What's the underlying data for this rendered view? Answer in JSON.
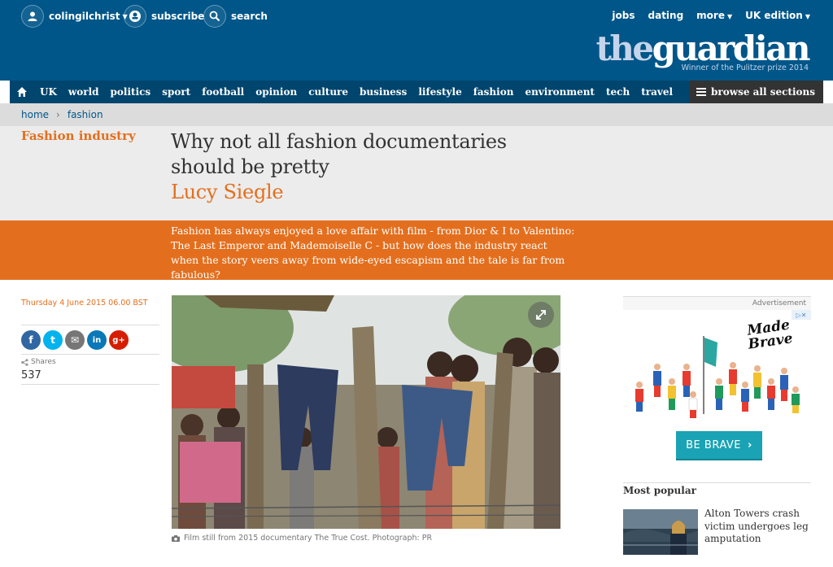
{
  "header": {
    "user_label": "colingilchrist",
    "subscribe_label": "subscribe",
    "search_label": "search",
    "right_links": [
      "jobs",
      "dating",
      "more",
      "UK edition"
    ],
    "logo_the": "the",
    "logo_guardian": "guardian",
    "logo_tagline": "Winner of the Pulitzer prize 2014"
  },
  "nav": {
    "items": [
      "UK",
      "world",
      "politics",
      "sport",
      "football",
      "opinion",
      "culture",
      "business",
      "lifestyle",
      "fashion",
      "environment",
      "tech",
      "travel"
    ],
    "browse_label": "browse all sections"
  },
  "breadcrumb": [
    "home",
    "fashion"
  ],
  "article": {
    "section": "Fashion industry",
    "headline": "Why not all fashion documentaries should be pretty",
    "byline": "Lucy Siegle",
    "standfirst": "Fashion has always enjoyed a love affair with film - from Dior & I to Valentino: The Last Emperor and Mademoiselle C - but how does the industry react when the story veers away from wide-eyed escapism and the tale is far from fabulous?",
    "date": "Thursday 4 June 2015 06.00 BST",
    "shares_label": "Shares",
    "shares_count": "537",
    "caption": "Film still from 2015 documentary The True Cost. Photograph: PR"
  },
  "share_buttons": [
    {
      "name": "facebook",
      "glyph": "f",
      "color": "#3067a3"
    },
    {
      "name": "twitter",
      "glyph": "t",
      "color": "#03b3ee"
    },
    {
      "name": "email",
      "glyph": "✉",
      "color": "#767676"
    },
    {
      "name": "linkedin",
      "glyph": "in",
      "color": "#0b78b7"
    },
    {
      "name": "googleplus",
      "glyph": "g+",
      "color": "#d61d00"
    }
  ],
  "sidebar": {
    "ad_label": "Advertisement",
    "ad_brand_line1": "Made",
    "ad_brand_line2": "Brave",
    "ad_cta": "BE BRAVE",
    "most_popular_title": "Most popular",
    "most_popular_items": [
      {
        "title": "Alton Towers crash victim undergoes leg amputation"
      }
    ]
  },
  "colors": {
    "brand_blue": "#005689",
    "nav_blue": "#00456e",
    "accent_orange": "#e36f1e",
    "cta_teal": "#1aa3b4"
  }
}
